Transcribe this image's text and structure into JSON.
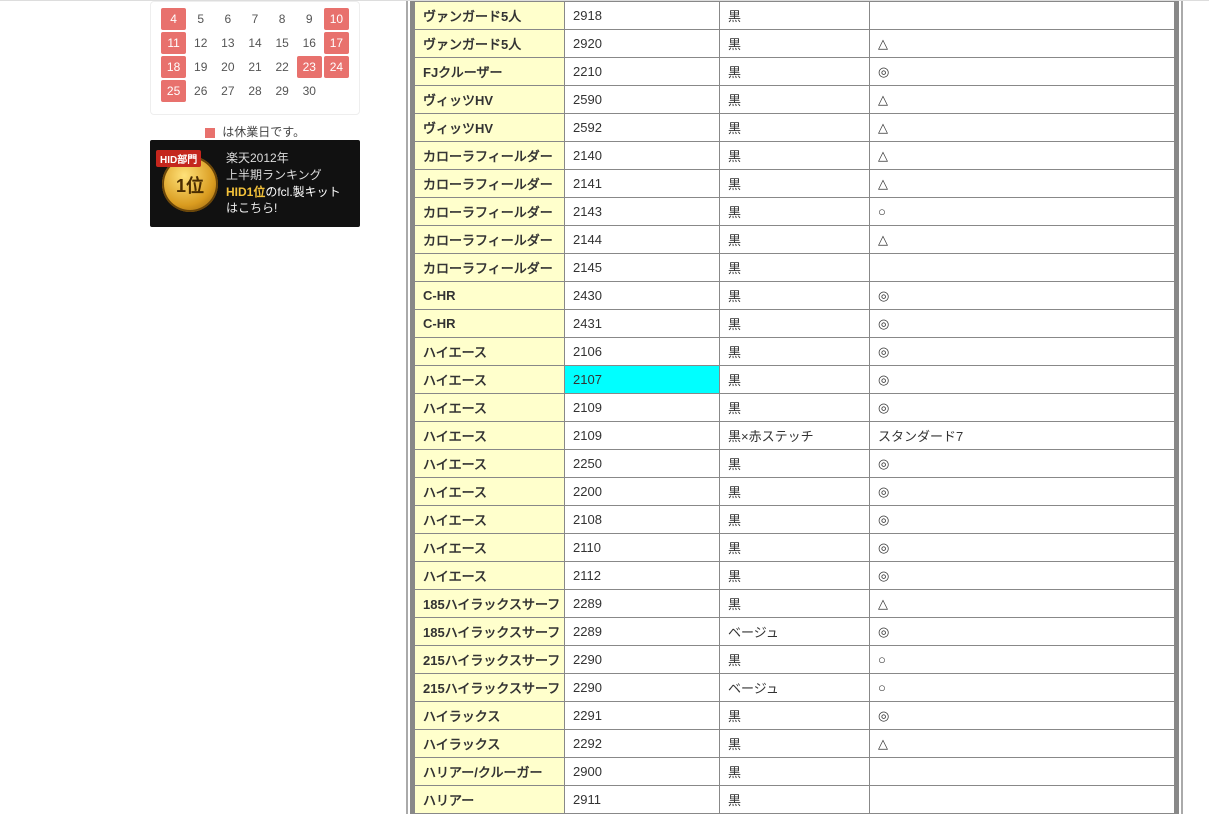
{
  "calendar": {
    "rows": [
      [
        {
          "d": "4",
          "h": true
        },
        {
          "d": "5",
          "h": false
        },
        {
          "d": "6",
          "h": false
        },
        {
          "d": "7",
          "h": false
        },
        {
          "d": "8",
          "h": false
        },
        {
          "d": "9",
          "h": false
        },
        {
          "d": "10",
          "h": true
        }
      ],
      [
        {
          "d": "11",
          "h": true
        },
        {
          "d": "12",
          "h": false
        },
        {
          "d": "13",
          "h": false
        },
        {
          "d": "14",
          "h": false
        },
        {
          "d": "15",
          "h": false
        },
        {
          "d": "16",
          "h": false
        },
        {
          "d": "17",
          "h": true
        }
      ],
      [
        {
          "d": "18",
          "h": true
        },
        {
          "d": "19",
          "h": false
        },
        {
          "d": "20",
          "h": false
        },
        {
          "d": "21",
          "h": false
        },
        {
          "d": "22",
          "h": false
        },
        {
          "d": "23",
          "h": true
        },
        {
          "d": "24",
          "h": true
        }
      ],
      [
        {
          "d": "25",
          "h": true
        },
        {
          "d": "26",
          "h": false
        },
        {
          "d": "27",
          "h": false
        },
        {
          "d": "28",
          "h": false
        },
        {
          "d": "29",
          "h": false
        },
        {
          "d": "30",
          "h": false
        },
        {
          "d": "",
          "h": false
        }
      ]
    ],
    "legend": "は休業日です。"
  },
  "banner": {
    "tag": "HID部門",
    "rank": "1位",
    "line1": "楽天2012年",
    "line1b": "上半期ランキング",
    "line2_accent": "HID1位",
    "line2_rest": "のfcl.製キット",
    "line3": "はこちら!"
  },
  "table": {
    "rows": [
      {
        "c1": "ヴァンガード5人",
        "c2": "2918",
        "c3": "黒",
        "c4": "",
        "hl": false
      },
      {
        "c1": "ヴァンガード5人",
        "c2": "2920",
        "c3": "黒",
        "c4": "△",
        "hl": false
      },
      {
        "c1": "FJクルーザー",
        "c2": "2210",
        "c3": "黒",
        "c4": "◎",
        "hl": false
      },
      {
        "c1": "ヴィッツHV",
        "c2": "2590",
        "c3": "黒",
        "c4": "△",
        "hl": false
      },
      {
        "c1": "ヴィッツHV",
        "c2": "2592",
        "c3": "黒",
        "c4": "△",
        "hl": false
      },
      {
        "c1": "カローラフィールダー",
        "c2": "2140",
        "c3": "黒",
        "c4": "△",
        "hl": false
      },
      {
        "c1": "カローラフィールダー",
        "c2": "2141",
        "c3": "黒",
        "c4": "△",
        "hl": false
      },
      {
        "c1": "カローラフィールダー",
        "c2": "2143",
        "c3": "黒",
        "c4": "○",
        "hl": false
      },
      {
        "c1": "カローラフィールダー",
        "c2": "2144",
        "c3": "黒",
        "c4": "△",
        "hl": false
      },
      {
        "c1": "カローラフィールダー",
        "c2": "2145",
        "c3": "黒",
        "c4": "",
        "hl": false
      },
      {
        "c1": "C-HR",
        "c2": "2430",
        "c3": "黒",
        "c4": "◎",
        "hl": false
      },
      {
        "c1": "C-HR",
        "c2": "2431",
        "c3": "黒",
        "c4": "◎",
        "hl": false
      },
      {
        "c1": "ハイエース",
        "c2": "2106",
        "c3": "黒",
        "c4": "◎",
        "hl": false
      },
      {
        "c1": "ハイエース",
        "c2": "2107",
        "c3": "黒",
        "c4": "◎",
        "hl": true
      },
      {
        "c1": "ハイエース",
        "c2": "2109",
        "c3": "黒",
        "c4": "◎",
        "hl": false
      },
      {
        "c1": "ハイエース",
        "c2": "2109",
        "c3": "黒×赤ステッチ",
        "c4": "スタンダード7",
        "hl": false
      },
      {
        "c1": "ハイエース",
        "c2": "2250",
        "c3": "黒",
        "c4": "◎",
        "hl": false
      },
      {
        "c1": "ハイエース",
        "c2": "2200",
        "c3": "黒",
        "c4": "◎",
        "hl": false
      },
      {
        "c1": "ハイエース",
        "c2": "2108",
        "c3": "黒",
        "c4": "◎",
        "hl": false
      },
      {
        "c1": "ハイエース",
        "c2": "2110",
        "c3": "黒",
        "c4": "◎",
        "hl": false
      },
      {
        "c1": "ハイエース",
        "c2": "2112",
        "c3": "黒",
        "c4": "◎",
        "hl": false
      },
      {
        "c1": "185ハイラックスサーフ",
        "c2": "2289",
        "c3": "黒",
        "c4": "△",
        "hl": false
      },
      {
        "c1": "185ハイラックスサーフ",
        "c2": "2289",
        "c3": "ベージュ",
        "c4": "◎",
        "hl": false
      },
      {
        "c1": "215ハイラックスサーフ",
        "c2": "2290",
        "c3": "黒",
        "c4": "○",
        "hl": false
      },
      {
        "c1": "215ハイラックスサーフ",
        "c2": "2290",
        "c3": "ベージュ",
        "c4": "○",
        "hl": false
      },
      {
        "c1": "ハイラックス",
        "c2": "2291",
        "c3": "黒",
        "c4": "◎",
        "hl": false
      },
      {
        "c1": "ハイラックス",
        "c2": "2292",
        "c3": "黒",
        "c4": "△",
        "hl": false
      },
      {
        "c1": "ハリアー/クルーガー",
        "c2": "2900",
        "c3": "黒",
        "c4": "",
        "hl": false
      },
      {
        "c1": "ハリアー",
        "c2": "2911",
        "c3": "黒",
        "c4": "",
        "hl": false
      }
    ]
  }
}
